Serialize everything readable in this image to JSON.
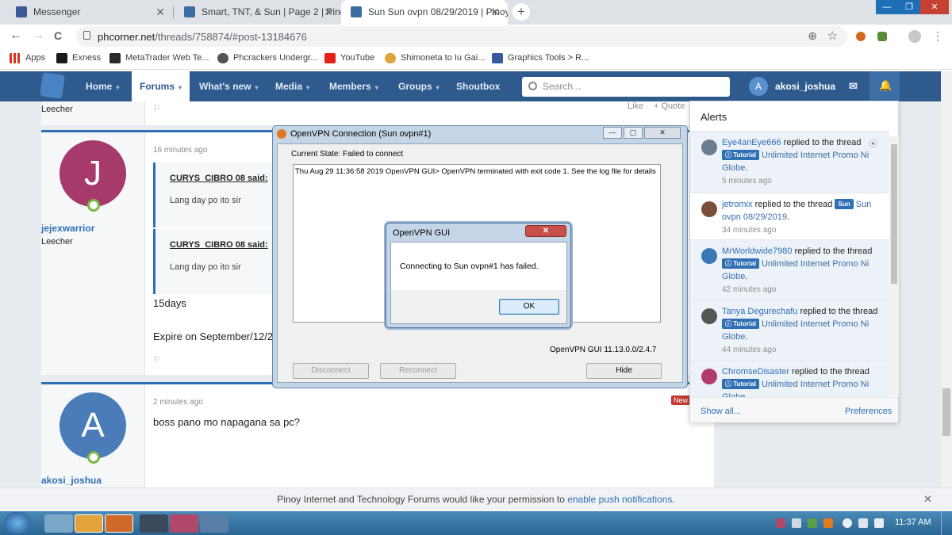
{
  "browser": {
    "tabs": [
      {
        "title": "Messenger",
        "active": false
      },
      {
        "title": "Smart, TNT, & Sun | Page 2 | Pino",
        "active": false
      },
      {
        "title": "Sun Sun ovpn 08/29/2019 | Pinoy",
        "active": true
      }
    ],
    "new_tab_label": "+",
    "window_controls": [
      "—",
      "❐",
      "✕"
    ],
    "url_host": "phcorner.net",
    "url_path": "/threads/758874/#post-13184676",
    "nav": {
      "back": "←",
      "forward": "→",
      "reload": "C"
    },
    "bookmarks": [
      "Apps",
      "Exness",
      "MetaTrader Web Te...",
      "Phcrackers Undergr...",
      "YouTube",
      "Shimoneta to Iu Gai...",
      "Graphics Tools > R..."
    ]
  },
  "site": {
    "nav": [
      "Home",
      "Forums",
      "What's new",
      "Media",
      "Members",
      "Groups",
      "Shoutbox"
    ],
    "search_placeholder": "Search...",
    "user_initial": "A",
    "username": "akosi_joshua",
    "envelope": "✉",
    "bell": "🔔"
  },
  "posts": [
    {
      "role": "Leecher",
      "like": "Like",
      "quote": "+ Quote"
    },
    {
      "initial": "J",
      "avatar_color": "#a63a6a",
      "username": "jejexwarrior",
      "role": "Leecher",
      "time": "16 minutes ago",
      "quotes": [
        {
          "author": "CURYS_CIBRO 08 said:",
          "text": "Lang day po ito sir"
        },
        {
          "author": "CURYS_CIBRO 08 said:",
          "text": "Lang day po ito sir"
        }
      ],
      "body": [
        "15days",
        "Expire on September/12/2"
      ]
    },
    {
      "initial": "A",
      "avatar_color": "#4a7cb9",
      "username": "akosi_joshua",
      "time": "2 minutes ago",
      "badge": "New",
      "body": "boss pano mo napagana sa pc?"
    }
  ],
  "openvpn": {
    "title": "OpenVPN Connection (Sun ovpn#1)",
    "state": "Current State: Failed to connect",
    "log": "Thu Aug 29 11:36:58 2019 OpenVPN GUI> OpenVPN terminated with exit code 1. See the log file for details",
    "version": "OpenVPN GUI 11.13.0.0/2.4.7",
    "buttons": {
      "disconnect": "Disconnect",
      "reconnect": "Reconnect",
      "hide": "Hide"
    }
  },
  "dialog": {
    "title": "OpenVPN GUI",
    "message": "Connecting to Sun ovpn#1 has failed.",
    "ok": "OK",
    "close": "✕"
  },
  "alerts": {
    "title": "Alerts",
    "items": [
      {
        "user": "Eye4anEye666",
        "action": " replied to the thread ",
        "prefix": "ⓘ Tutorial",
        "thread": "Unlimited Internet Promo Ni Globe",
        "tail": ".",
        "time": "5 minutes ago",
        "color": "#6b7c8c"
      },
      {
        "user": "jetromix",
        "action": " replied to the thread ",
        "prefix": "Sun",
        "thread": "Sun ovpn 08/29/2019",
        "tail": ".",
        "time": "34 minutes ago",
        "color": "#7a4e3a"
      },
      {
        "user": "MrWorldwide7980",
        "action": " replied to the thread ",
        "prefix": "ⓘ Tutorial",
        "thread": "Unlimited Internet Promo Ni Globe",
        "tail": ".",
        "time": "42 minutes ago",
        "color": "#3b78b5"
      },
      {
        "user": "Tanya Degurechafu",
        "action": " replied to the thread ",
        "prefix": "ⓘ Tutorial",
        "thread": "Unlimited Internet Promo Ni Globe",
        "tail": ".",
        "time": "44 minutes ago",
        "color": "#555"
      },
      {
        "user": "ChromseDisaster",
        "action": " replied to the thread ",
        "prefix": "ⓘ Tutorial",
        "thread": "Unlimited Internet Promo Ni Globe",
        "tail": "",
        "time": "",
        "color": "#b03a6a"
      }
    ],
    "show_all": "Show all...",
    "preferences": "Preferences"
  },
  "push": {
    "text": "Pinoy Internet and Technology Forums would like your permission to ",
    "link": "enable push notifications",
    "tail": ".",
    "close": "✕"
  },
  "taskbar": {
    "clock": "11:37 AM"
  }
}
